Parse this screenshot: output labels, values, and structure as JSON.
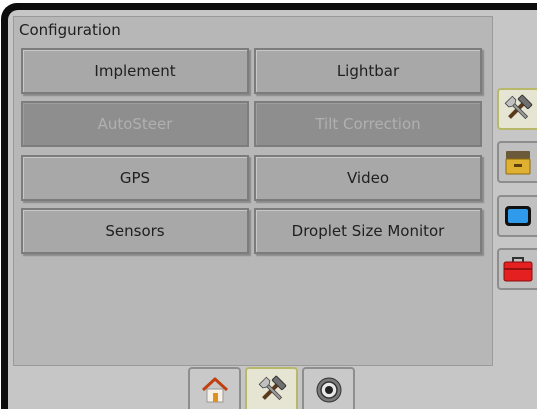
{
  "panel": {
    "title": "Configuration"
  },
  "buttons": [
    {
      "label": "Implement",
      "enabled": true
    },
    {
      "label": "Lightbar",
      "enabled": true
    },
    {
      "label": "AutoSteer",
      "enabled": false
    },
    {
      "label": "Tilt Correction",
      "enabled": false
    },
    {
      "label": "GPS",
      "enabled": true
    },
    {
      "label": "Video",
      "enabled": true
    },
    {
      "label": "Sensors",
      "enabled": true
    },
    {
      "label": "Droplet Size Monitor",
      "enabled": true
    }
  ],
  "side_tabs": [
    {
      "icon": "tools-icon",
      "active": true
    },
    {
      "icon": "system-drawer-icon",
      "active": false
    },
    {
      "icon": "console-screen-icon",
      "active": false
    },
    {
      "icon": "toolbox-icon",
      "active": false
    }
  ],
  "bottom_tabs": [
    {
      "icon": "home-icon",
      "active": false
    },
    {
      "icon": "tools-icon",
      "active": true
    },
    {
      "icon": "gauge-icon",
      "active": false
    }
  ]
}
